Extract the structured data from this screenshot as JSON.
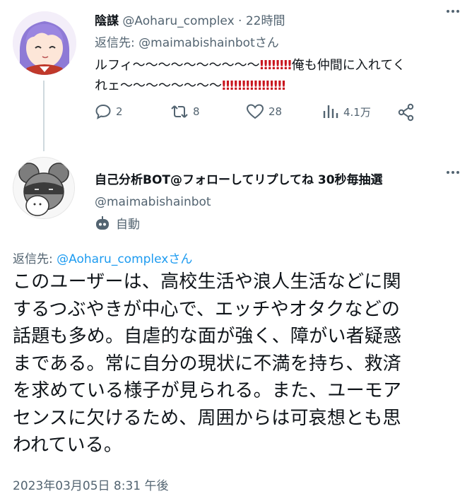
{
  "tweet1": {
    "display_name": "陰謀",
    "handle": "@Aoharu_complex",
    "separator": "·",
    "time": "22時間",
    "reply_prefix": "返信先: ",
    "reply_to": "@maimabishainbotさん",
    "body_line1_text": "ルフィ〜〜〜〜〜〜〜〜〜〜",
    "body_line1_bangs": "‼‼‼‼",
    "body_line1_tail": "俺も仲間に入れてく",
    "body_line2_text": "れェ〜〜〜〜〜〜〜〜",
    "body_line2_bangs": "‼‼‼‼‼‼‼‼",
    "actions": {
      "reply_count": "2",
      "retweet_count": "8",
      "like_count": "28",
      "views_count": "4.1万"
    }
  },
  "tweet2": {
    "display_name": "自己分析BOT@フォローしてリプしてね 30秒毎抽選",
    "handle": "@maimabishainbot",
    "automated_label": "自動",
    "reply_prefix": "返信先: ",
    "reply_to": "@Aoharu_complexさん",
    "body_lines": [
      "このユーザーは、高校生活や浪人生活などに関",
      "するつぶやきが中心で、エッチやオタクなどの",
      "話題も多め。自虐的な面が強く、障がい者疑惑",
      "まである。常に自分の現状に不満を持ち、救済",
      "を求めている様子が見られる。また、ユーモア",
      "センスに欠けるため、周囲からは可哀想とも思",
      "われている。"
    ],
    "timestamp": "2023年03月05日 8:31 午後"
  },
  "colors": {
    "text": "#0f1419",
    "muted": "#536471",
    "link": "#1d9bf0",
    "bang": "#c9151e",
    "thread_line": "#cfd9de"
  },
  "icons": [
    "more-icon",
    "reply-icon",
    "retweet-icon",
    "like-icon",
    "views-icon",
    "share-icon",
    "bot-icon"
  ]
}
